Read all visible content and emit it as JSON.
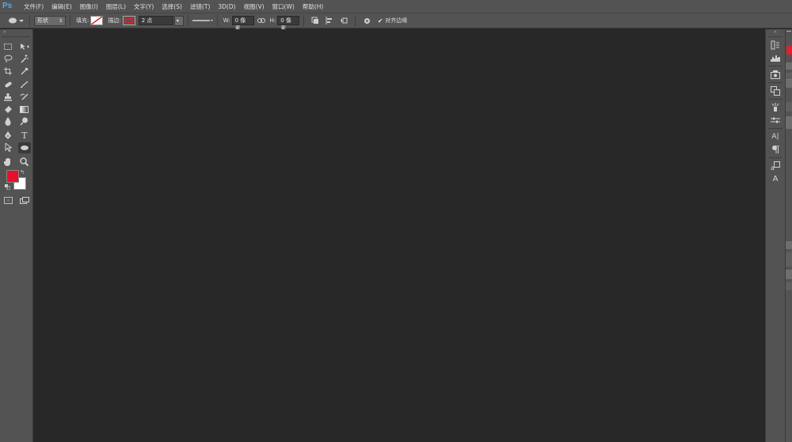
{
  "app": {
    "logo": "Ps"
  },
  "menu": [
    "文件(F)",
    "编辑(E)",
    "图像(I)",
    "图层(L)",
    "文字(Y)",
    "选择(S)",
    "滤镜(T)",
    "3D(D)",
    "视图(V)",
    "窗口(W)",
    "帮助(H)"
  ],
  "options": {
    "mode_value": "形状",
    "fill_label": "填充:",
    "stroke_label": "描边:",
    "stroke_width": "2 点",
    "w_label": "W:",
    "w_value": "0 像素",
    "h_label": "H:",
    "h_value": "0 像素",
    "align_edges_label": "对齐边缘",
    "stroke_color": "#e0202a"
  },
  "colors": {
    "foreground": "#e8102a",
    "background": "#ffffff"
  },
  "tools": [
    [
      "rect-marquee-icon",
      "move-icon"
    ],
    [
      "lasso-icon",
      "magic-wand-icon"
    ],
    [
      "crop-icon",
      "eyedropper-icon"
    ],
    [
      "spot-healing-icon",
      "brush-icon"
    ],
    [
      "clone-stamp-icon",
      "history-brush-icon"
    ],
    [
      "eraser-icon",
      "gradient-icon"
    ],
    [
      "blur-icon",
      "dodge-icon"
    ],
    [
      "pen-icon",
      "type-icon"
    ],
    [
      "path-selection-icon",
      "ellipse-icon"
    ],
    [
      "hand-icon",
      "zoom-icon"
    ]
  ],
  "type_tool_glyph": "T",
  "dock": [
    "history-icon",
    "histogram-icon",
    "navigator-icon",
    "layer-comps-icon",
    "brush-presets-icon",
    "adjustments-icon",
    "character-icon",
    "paragraph-icon",
    "char-styles-icon",
    "para-styles-icon"
  ],
  "character_glyph": "A|",
  "para_styles_glyph": "A"
}
